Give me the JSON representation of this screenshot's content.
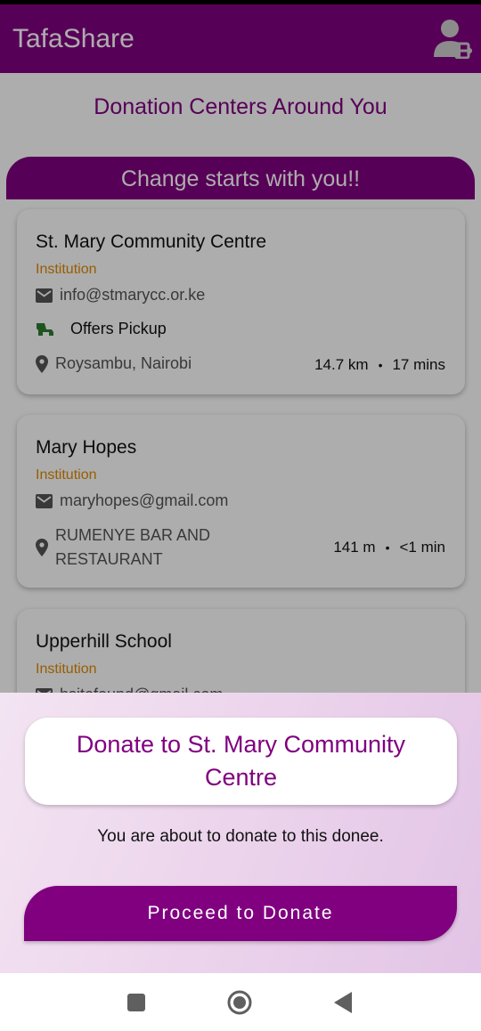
{
  "app": {
    "title": "TafaShare"
  },
  "page": {
    "heading": "Donation Centers Around You",
    "banner": "Change starts with you!!"
  },
  "centers": [
    {
      "name": "St. Mary Community Centre",
      "type": "Institution",
      "email": "info@stmarycc.or.ke",
      "pickup_label": "Offers Pickup",
      "location": "Roysambu, Nairobi",
      "distance": "14.7 km",
      "dot": "•",
      "time": "17 mins"
    },
    {
      "name": "Mary Hopes",
      "type": "Institution",
      "email": "maryhopes@gmail.com",
      "location_line1": "RUMENYE BAR AND",
      "location_line2": "RESTAURANT",
      "distance": "141 m",
      "dot": "•",
      "time": "<1 min"
    },
    {
      "name": "Upperhill School",
      "type": "Institution",
      "email": "hsitofound@gmail.com"
    }
  ],
  "sheet": {
    "title": "Donate to St. Mary Community Centre",
    "message": "You are about to donate to this donee.",
    "button_label": "Proceed to Donate"
  },
  "colors": {
    "primary": "#800080",
    "institution": "#e08a00",
    "pickup_icon": "#2e7d32"
  },
  "icons": {
    "account": "account-logout-icon",
    "email": "email-icon",
    "truck": "truck-icon",
    "location": "location-pin-icon",
    "nav_recents": "square-icon",
    "nav_home": "circle-icon",
    "nav_back": "triangle-back-icon"
  }
}
